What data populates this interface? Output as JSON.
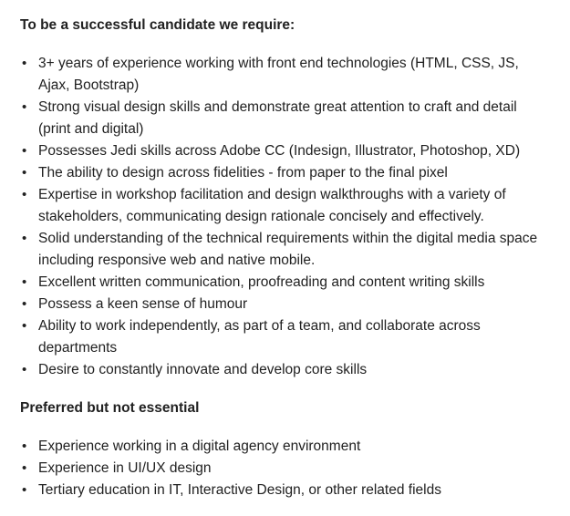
{
  "required": {
    "heading": "To be a successful candidate we require:",
    "items": [
      "3+ years of experience working with front end technologies (HTML, CSS, JS, Ajax, Bootstrap)",
      "Strong visual design skills and demonstrate great attention to craft and detail (print and digital)",
      "Possesses Jedi skills across Adobe CC (Indesign, Illustrator, Photoshop, XD)",
      "The ability to design across fidelities - from paper to the final pixel",
      "Expertise in workshop facilitation and design walkthroughs with a variety of stakeholders, communicating design rationale concisely and effectively.",
      "Solid understanding of the technical requirements within the digital media space including responsive web and native mobile.",
      "Excellent written communication, proofreading and content writing skills",
      "Possess a keen sense of humour",
      "Ability to work independently, as part of a team, and collaborate across departments",
      "Desire to constantly innovate and develop core skills"
    ]
  },
  "preferred": {
    "heading": "Preferred but not essential",
    "items": [
      "Experience working in a digital agency environment",
      "Experience in UI/UX design",
      "Tertiary education in IT, Interactive Design, or other related fields"
    ]
  },
  "bullet_glyph": "•"
}
